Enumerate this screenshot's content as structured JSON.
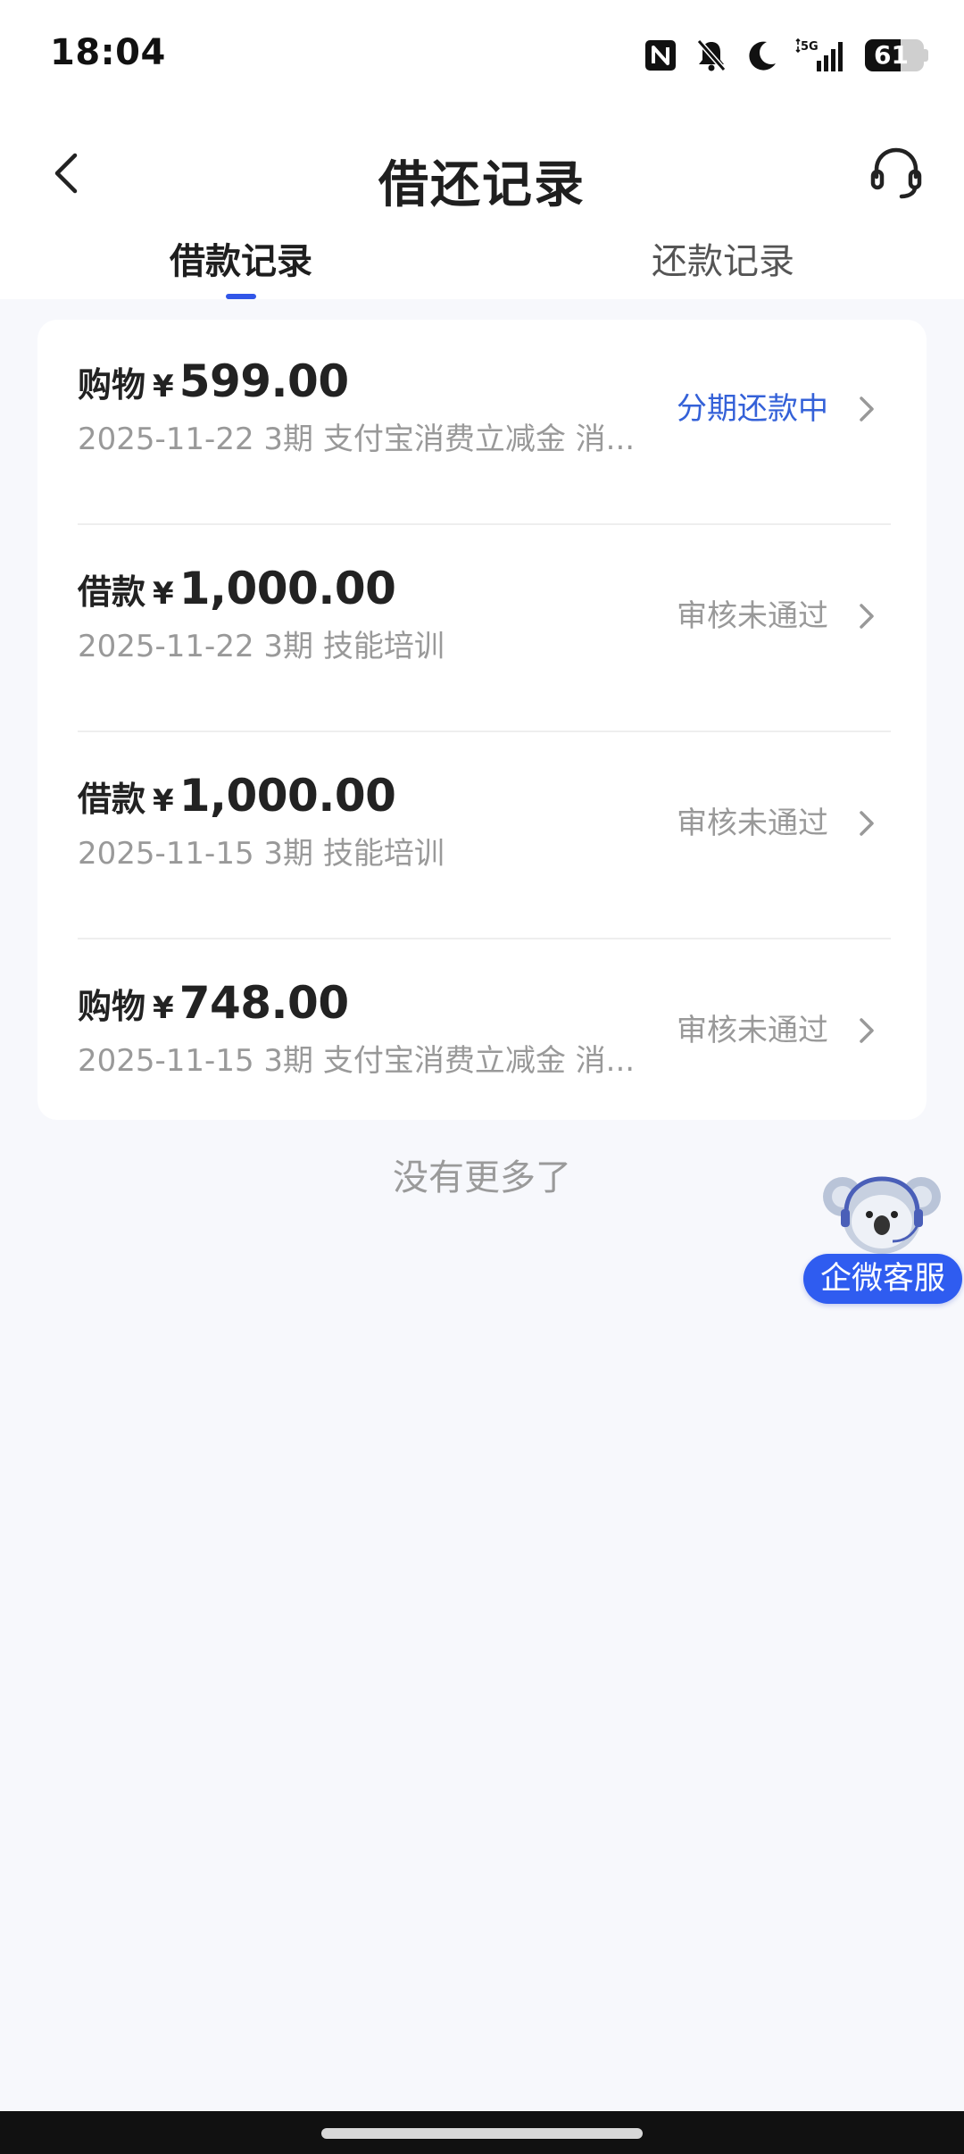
{
  "status_bar": {
    "time": "18:04",
    "battery": "61",
    "network": "5G",
    "icons": [
      "nfc-icon",
      "mute-icon",
      "moon-icon",
      "signal-icon",
      "battery-icon"
    ]
  },
  "header": {
    "title": "借还记录",
    "back_icon": "back-arrow-icon",
    "service_icon": "headset-icon"
  },
  "tabs": [
    {
      "label": "借款记录",
      "active": true
    },
    {
      "label": "还款记录",
      "active": false
    }
  ],
  "records": [
    {
      "type": "购物",
      "currency": "¥",
      "amount": "599.00",
      "sub": "2025-11-22 3期  支付宝消费立减金 消...",
      "status": "分期还款中",
      "status_color": "#3461d8"
    },
    {
      "type": "借款",
      "currency": "¥",
      "amount": "1,000.00",
      "sub": "2025-11-22 3期  技能培训",
      "status": "审核未通过",
      "status_color": "#999999"
    },
    {
      "type": "借款",
      "currency": "¥",
      "amount": "1,000.00",
      "sub": "2025-11-15 3期  技能培训",
      "status": "审核未通过",
      "status_color": "#999999"
    },
    {
      "type": "购物",
      "currency": "¥",
      "amount": "748.00",
      "sub": "2025-11-15 3期  支付宝消费立减金 消...",
      "status": "审核未通过",
      "status_color": "#999999"
    }
  ],
  "footer_text": "没有更多了",
  "floating_service": {
    "label": "企微客服",
    "icon": "koala-mascot-icon"
  },
  "colors": {
    "accent": "#3156e8",
    "page_bg": "#f7f8fc",
    "muted_text": "#999999"
  }
}
